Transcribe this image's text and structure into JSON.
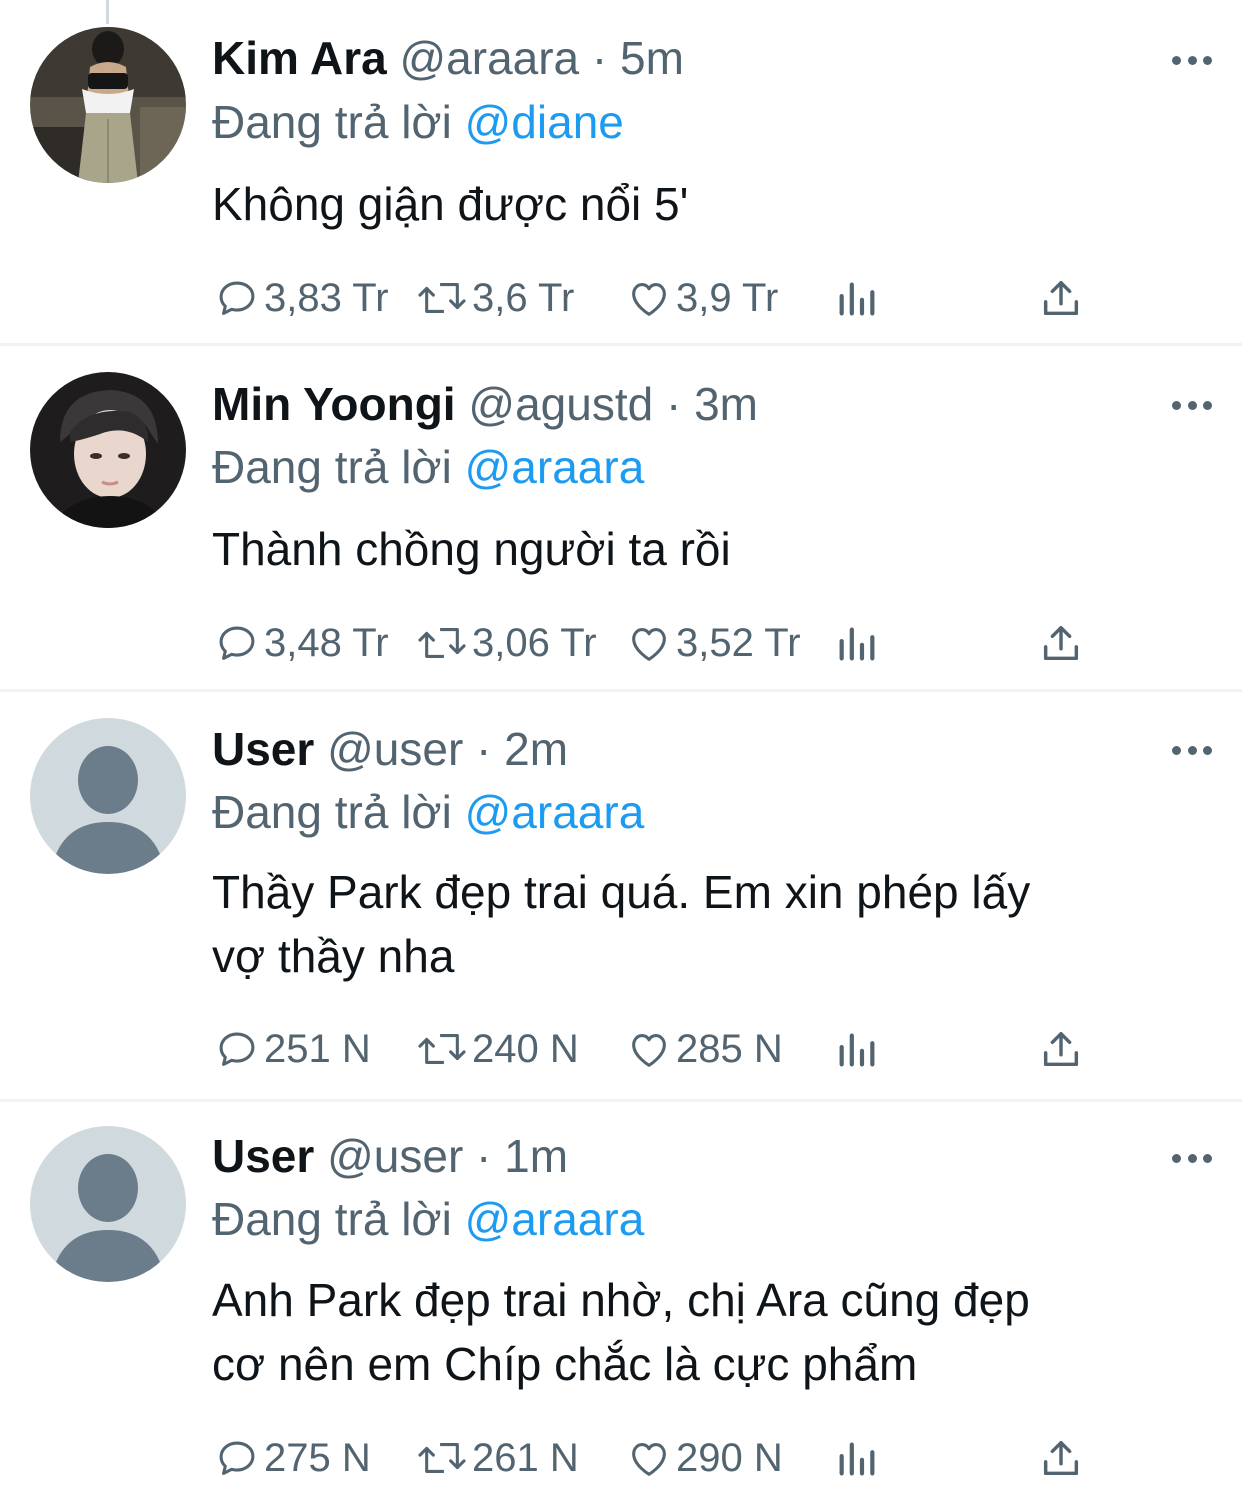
{
  "reply_prefix": "Đang trả lời",
  "tweets": [
    {
      "name": "Kim Ara",
      "meta": "@araara · 5m",
      "reply_to": "@diane",
      "lines": [
        "Không giận được nổi 5'"
      ],
      "replies": "3,83 Tr",
      "retweets": "3,6 Tr",
      "likes": "3,9 Tr",
      "avatar": "photo-woman"
    },
    {
      "name": "Min Yoongi",
      "meta": "@agustd · 3m",
      "reply_to": "@araara",
      "lines": [
        "Thành chồng người ta rồi"
      ],
      "replies": "3,48 Tr",
      "retweets": "3,06 Tr",
      "likes": "3,52 Tr",
      "avatar": "photo-man"
    },
    {
      "name": "User",
      "meta": "@user · 2m",
      "reply_to": "@araara",
      "lines": [
        "Thầy Park đẹp trai quá. Em xin phép lấy",
        "vợ thầy nha"
      ],
      "replies": "251 N",
      "retweets": "240 N",
      "likes": "285 N",
      "avatar": "default-avatar"
    },
    {
      "name": "User",
      "meta": "@user · 1m",
      "reply_to": "@araara",
      "lines": [
        "Anh Park đẹp trai nhờ, chị Ara cũng đẹp",
        "cơ nên em Chíp chắc là cực phẩm"
      ],
      "replies": "275 N",
      "retweets": "261 N",
      "likes": "290 N",
      "avatar": "default-avatar"
    }
  ],
  "colors": {
    "text": "#0f1419",
    "secondary": "#536471",
    "link": "#1d9bf0",
    "divider": "#eff3f4"
  }
}
